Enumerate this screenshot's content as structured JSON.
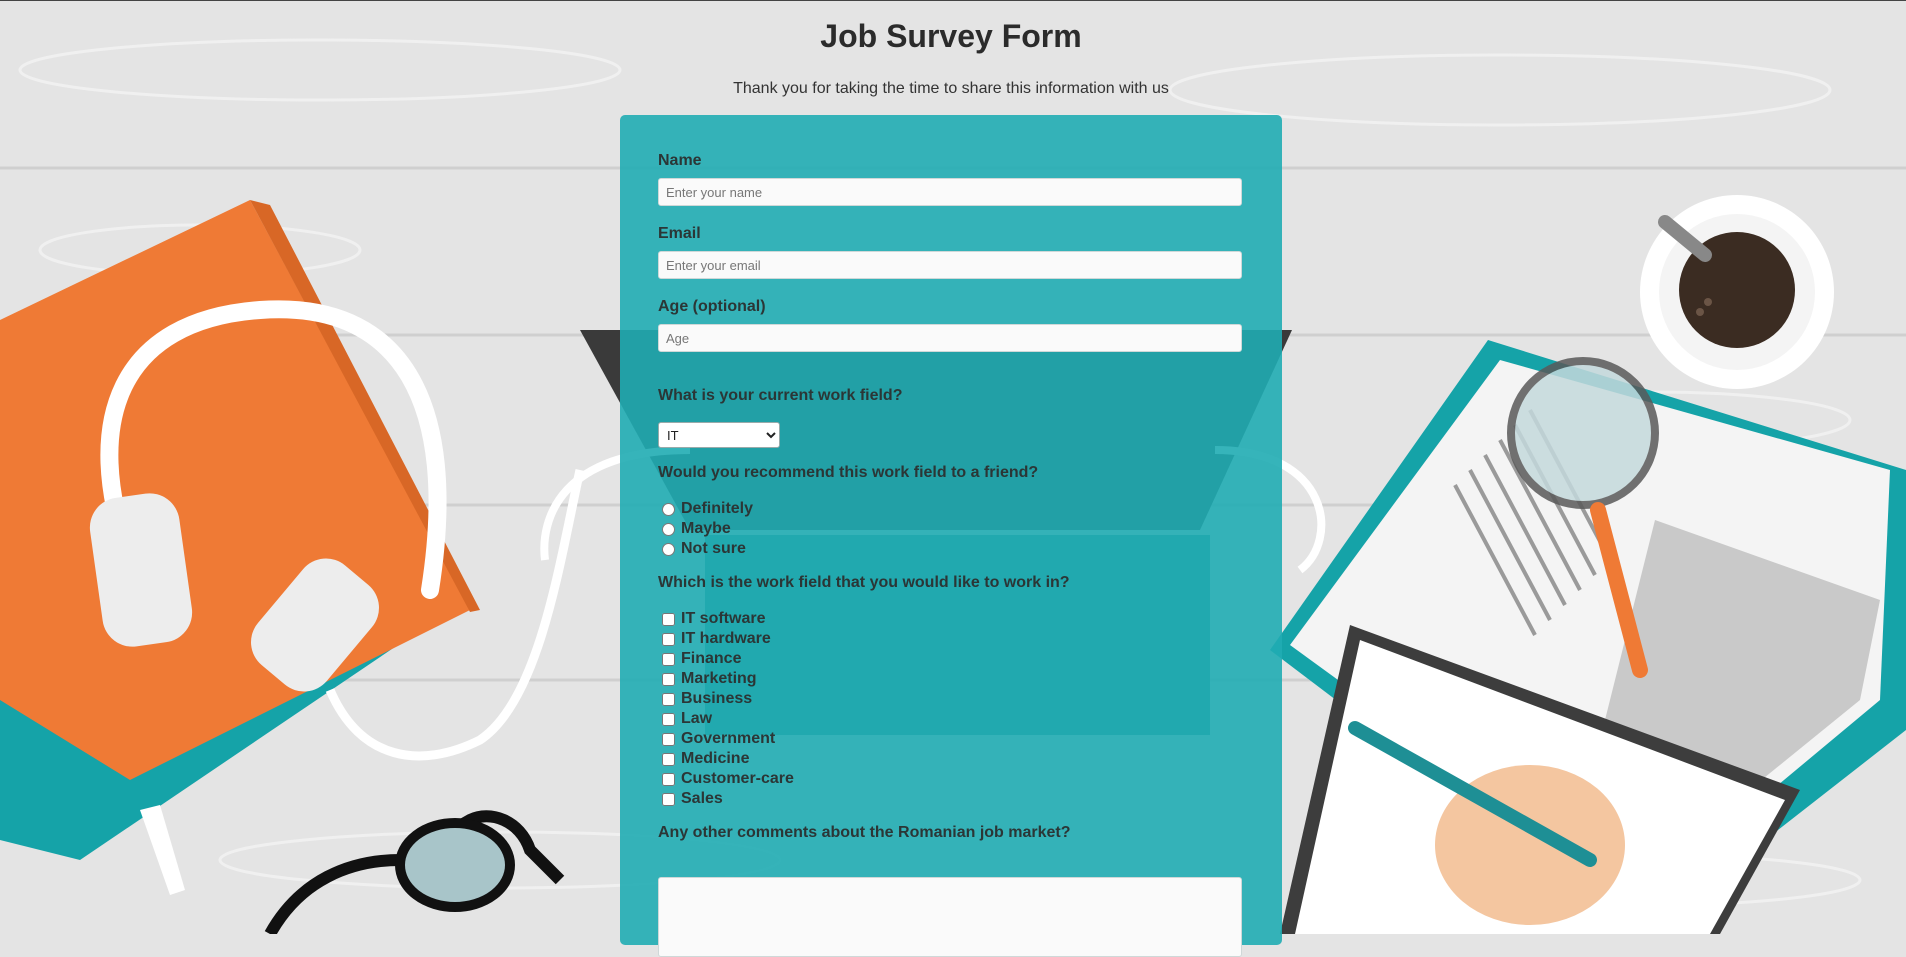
{
  "page": {
    "title": "Job Survey Form",
    "subtitle": "Thank you for taking the time to share this information with us"
  },
  "form": {
    "name": {
      "label": "Name",
      "placeholder": "Enter your name",
      "value": ""
    },
    "email": {
      "label": "Email",
      "placeholder": "Enter your email",
      "value": ""
    },
    "age": {
      "label": "Age (optional)",
      "placeholder": "Age",
      "value": ""
    },
    "work_field": {
      "question": "What is your current work field?",
      "selected": "IT"
    },
    "recommend": {
      "question": "Would you recommend this work field to a friend?",
      "options": [
        "Definitely",
        "Maybe",
        "Not sure"
      ]
    },
    "desired_fields": {
      "question": "Which is the work field that you would like to work in?",
      "options": [
        "IT software",
        "IT hardware",
        "Finance",
        "Marketing",
        "Business",
        "Law",
        "Government",
        "Medicine",
        "Customer-care",
        "Sales"
      ]
    },
    "comments": {
      "question": "Any other comments about the Romanian job market?",
      "value": ""
    }
  },
  "colors": {
    "panel": "#20acb2",
    "background": "#e4e4e4",
    "accent_orange": "#ef7a35",
    "accent_teal": "#15a3a8"
  },
  "icons": [
    "notebook-icon",
    "headphones-icon",
    "glasses-icon",
    "laptop-icon",
    "coffee-cup-icon",
    "magnifier-icon",
    "open-book-icon",
    "hand-pencil-icon"
  ]
}
